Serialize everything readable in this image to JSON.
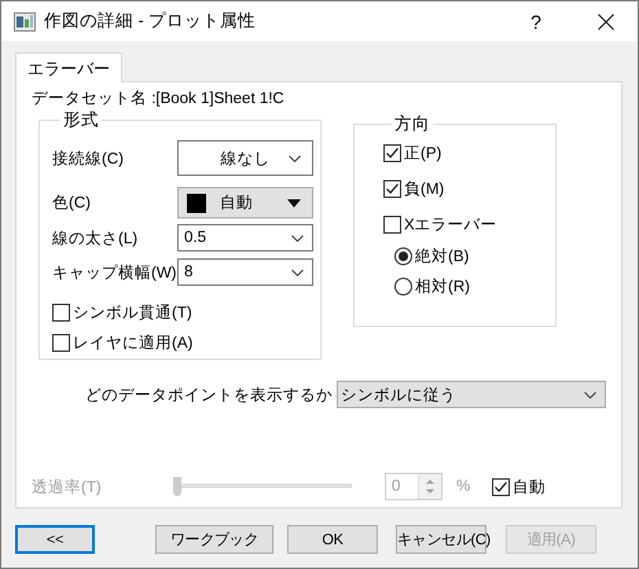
{
  "window": {
    "title": "作図の詳細 - プロット属性",
    "help": "?"
  },
  "tabs": [
    {
      "label": "エラーバー",
      "selected": true
    }
  ],
  "dataset_label": "データセット名 :[Book 1]Sheet 1!C",
  "format_group": {
    "title": "形式",
    "fields": [
      {
        "kind": "button-dropdown",
        "label": "接続線(C)",
        "value": "線なし"
      },
      {
        "kind": "color",
        "label": "色(C)",
        "value": "自動",
        "color": "#000000"
      },
      {
        "kind": "combo",
        "label": "線の太さ(L)",
        "value": "0.5"
      },
      {
        "kind": "combo",
        "label": "キャップ横幅(W)",
        "value": "8"
      }
    ],
    "checkboxes": [
      {
        "label": "シンボル貫通(T)",
        "checked": false
      },
      {
        "label": "レイヤに適用(A)",
        "checked": false
      }
    ]
  },
  "direction_group": {
    "title": "方向",
    "checkboxes": [
      {
        "label": "正(P)",
        "checked": true
      },
      {
        "label": "負(M)",
        "checked": true
      },
      {
        "label": "Xエラーバー",
        "checked": false
      }
    ],
    "radios": [
      {
        "label": "絶対(B)",
        "selected": true
      },
      {
        "label": "相対(R)",
        "selected": false
      }
    ]
  },
  "display_points": {
    "label": "どのデータポイントを表示するか",
    "value": "シンボルに従う"
  },
  "transparency": {
    "label": "透過率(T)",
    "disabled": true,
    "level": 0,
    "value": "0",
    "unit": "%",
    "auto": {
      "label": "自動",
      "checked": true
    }
  },
  "buttons": [
    {
      "label": "<<",
      "focused": true,
      "disabled": false
    },
    {
      "label": "ワークブック",
      "focused": false,
      "disabled": false
    },
    {
      "label": "OK",
      "focused": false,
      "disabled": false
    },
    {
      "label": "キャンセル(C)",
      "focused": false,
      "disabled": false
    },
    {
      "label": "適用(A)",
      "focused": false,
      "disabled": true
    }
  ]
}
